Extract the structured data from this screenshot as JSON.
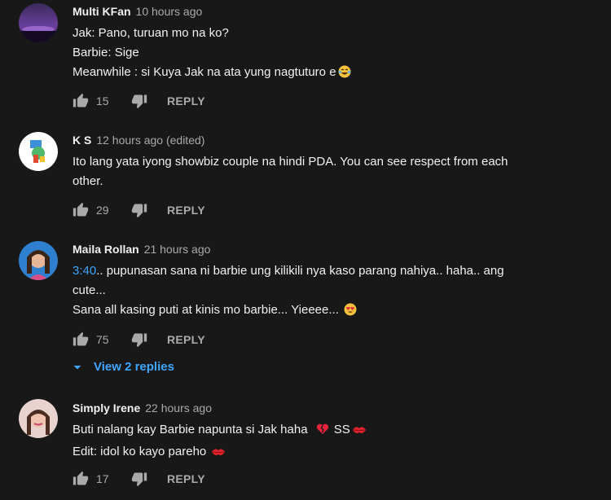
{
  "comments": [
    {
      "author": "Multi KFan",
      "time": "10 hours ago",
      "lines": [
        "Jak: Pano, turuan mo na ko?",
        "Barbie: Sige",
        "Meanwhile : si Kuya Jak na ata yung nagtuturo e"
      ],
      "emoji": "tears-of-joy-emoji",
      "likes": "15",
      "reply_label": "REPLY"
    },
    {
      "author": "K S",
      "time": "12 hours ago (edited)",
      "lines": [
        "Ito lang yata iyong showbiz couple na hindi PDA. You can see respect from each",
        "other."
      ],
      "likes": "29",
      "reply_label": "REPLY"
    },
    {
      "author": "Maila Rollan",
      "time": "21 hours ago",
      "timestamp_link": "3:40",
      "lines": [
        ".. pupunasan sana ni barbie ung kilikili nya kaso parang nahiya.. haha.. ang",
        "cute...",
        "Sana all kasing puti at kinis mo barbie... Yieeee..."
      ],
      "emoji": "heart-eyes-emoji",
      "likes": "75",
      "reply_label": "REPLY",
      "view_replies": "View 2 replies"
    },
    {
      "author": "Simply Irene",
      "time": "22 hours ago",
      "lines": [
        "Buti nalang kay Barbie napunta si Jak haha",
        "SS",
        "Edit: idol ko kayo pareho"
      ],
      "likes": "17",
      "reply_label": "REPLY"
    }
  ],
  "colors": {
    "background": "#181818",
    "text": "#f1f1f1",
    "secondary": "#aaaaaa",
    "link": "#3ea6ff"
  }
}
